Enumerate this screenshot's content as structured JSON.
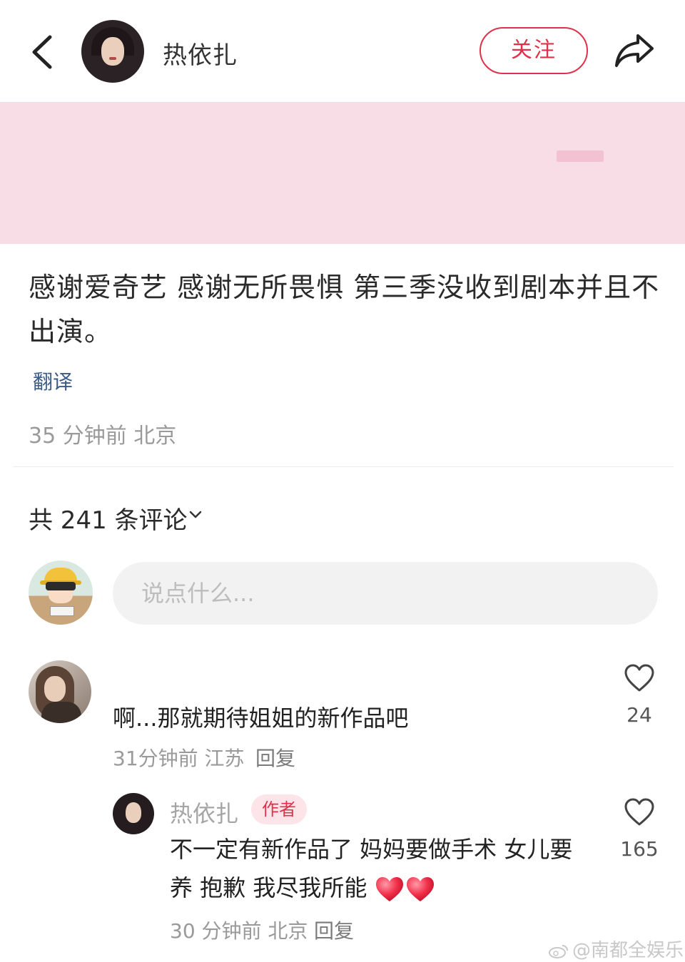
{
  "header": {
    "username": "热依扎",
    "follow_label": "关注",
    "back_icon": "chevron-left-icon",
    "share_icon": "share-arrow-icon"
  },
  "post": {
    "text": "感谢爱奇艺 感谢无所畏惧 第三季没收到剧本并且不出演。",
    "translate_label": "翻译",
    "meta": "35 分钟前 北京"
  },
  "comments_header": {
    "count_label": "共 241 条评论"
  },
  "input": {
    "placeholder": "说点什么..."
  },
  "comments": [
    {
      "text": "啊...那就期待姐姐的新作品吧",
      "meta": "31分钟前 江苏",
      "reply_label": "回复",
      "likes": "24",
      "replies": [
        {
          "name": "热依扎",
          "badge": "作者",
          "text": "不一定有新作品了 妈妈要做手术 女儿要养 抱歉 我尽我所能",
          "meta": "30 分钟前 北京",
          "reply_label": "回复",
          "likes": "165"
        }
      ]
    }
  ],
  "watermark": "@南都全娱乐",
  "colors": {
    "accent": "#e0314b",
    "media_band": "#f9dde6",
    "link": "#3c5a86",
    "meta_text": "#9a9a9a"
  }
}
